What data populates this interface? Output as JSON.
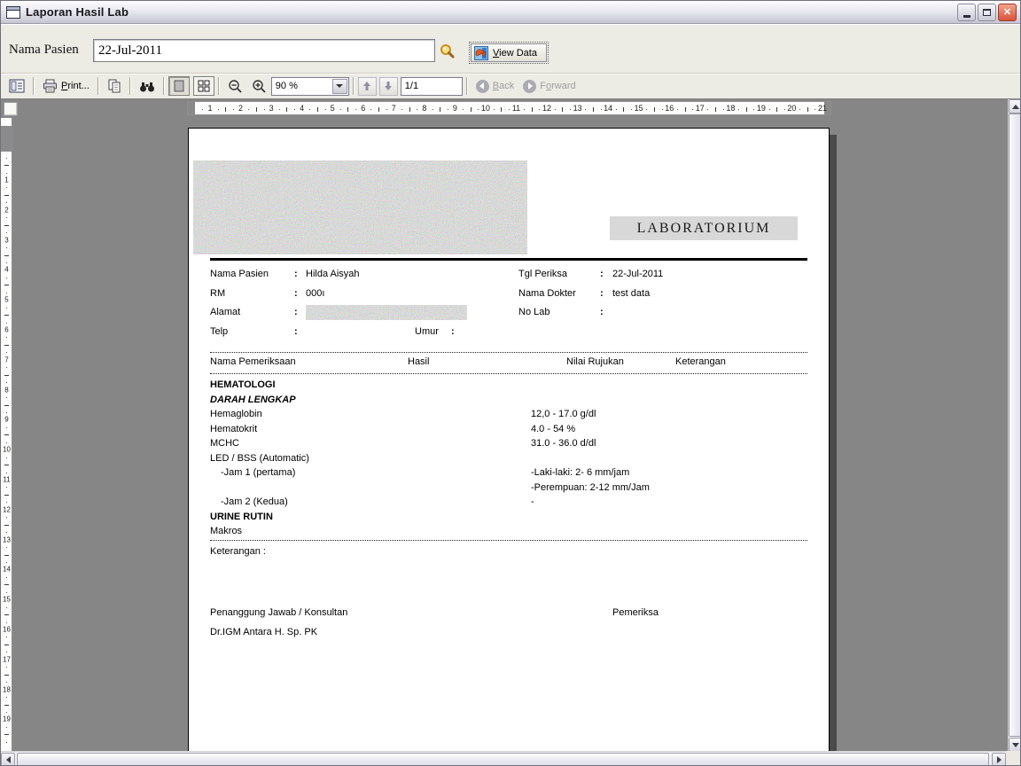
{
  "window": {
    "title": "Laporan Hasil Lab"
  },
  "form": {
    "label": "Nama Pasien",
    "value": "22-Jul-2011",
    "view_data": {
      "key": "V",
      "rest": "iew Data"
    }
  },
  "toolbar": {
    "print": {
      "key": "P",
      "rest": "rint..."
    },
    "zoom_value": "90 %",
    "page_value": "1/1",
    "back": {
      "key": "B",
      "rest": "ack"
    },
    "forward": {
      "pre": "F",
      "key": "o",
      "rest": "rward"
    }
  },
  "rulers": {
    "horizontal": [
      1,
      2,
      3,
      4,
      5,
      6,
      7,
      8,
      9,
      10,
      11,
      12,
      13,
      14,
      15,
      16,
      17,
      18,
      19,
      20,
      21
    ],
    "vertical": [
      1,
      2,
      3,
      4,
      5,
      6,
      7,
      8,
      9,
      10,
      11,
      12,
      13,
      14,
      15,
      16,
      17,
      18,
      19
    ]
  },
  "report": {
    "lab_title": "LABORATORIUM",
    "colon": ":",
    "patient": {
      "nama_label": "Nama Pasien",
      "nama": "Hilda Aisyah",
      "rm_label": "RM",
      "rm": "000ı",
      "alamat_label": "Alamat",
      "telp_label": "Telp",
      "umur_label": "Umur",
      "tgl_label": "Tgl Periksa",
      "tgl": "22-Jul-2011",
      "dokter_label": "Nama Dokter",
      "dokter": "test data",
      "nolab_label": "No Lab"
    },
    "columns": [
      "Nama Pemeriksaan",
      "Hasil",
      "Nilai Rujukan",
      "Keterangan"
    ],
    "rows": [
      {
        "style": "sec",
        "label": "HEMATOLOGI",
        "ref": ""
      },
      {
        "style": "ital",
        "label": "DARAH LENGKAP",
        "ref": ""
      },
      {
        "style": "item",
        "label": "Hemaglobin",
        "ref": "12,0 - 17.0 g/dl"
      },
      {
        "style": "item",
        "label": "Hematokrit",
        "ref": "4.0 - 54 %"
      },
      {
        "style": "item",
        "label": "MCHC",
        "ref": "31.0 - 36.0 d/dl"
      },
      {
        "style": "item",
        "label": "LED / BSS (Automatic)",
        "ref": ""
      },
      {
        "style": "ind",
        "label": "-Jam 1 (pertama)",
        "ref": "-Laki-laki: 2- 6 mm/jam"
      },
      {
        "style": "ind",
        "label": "",
        "ref": "-Perempuan: 2-12 mm/Jam"
      },
      {
        "style": "ind",
        "label": "-Jam 2 (Kedua)",
        "ref": "-"
      },
      {
        "style": "sec",
        "label": "URINE RUTIN",
        "ref": ""
      },
      {
        "style": "item",
        "label": "Makros",
        "ref": ""
      }
    ],
    "keterangan": "Keterangan :",
    "sign_left": "Penanggung Jawab / Konsultan",
    "sign_right": "Pemeriksa",
    "doctor": "Dr.IGM Antara H. Sp. PK"
  }
}
